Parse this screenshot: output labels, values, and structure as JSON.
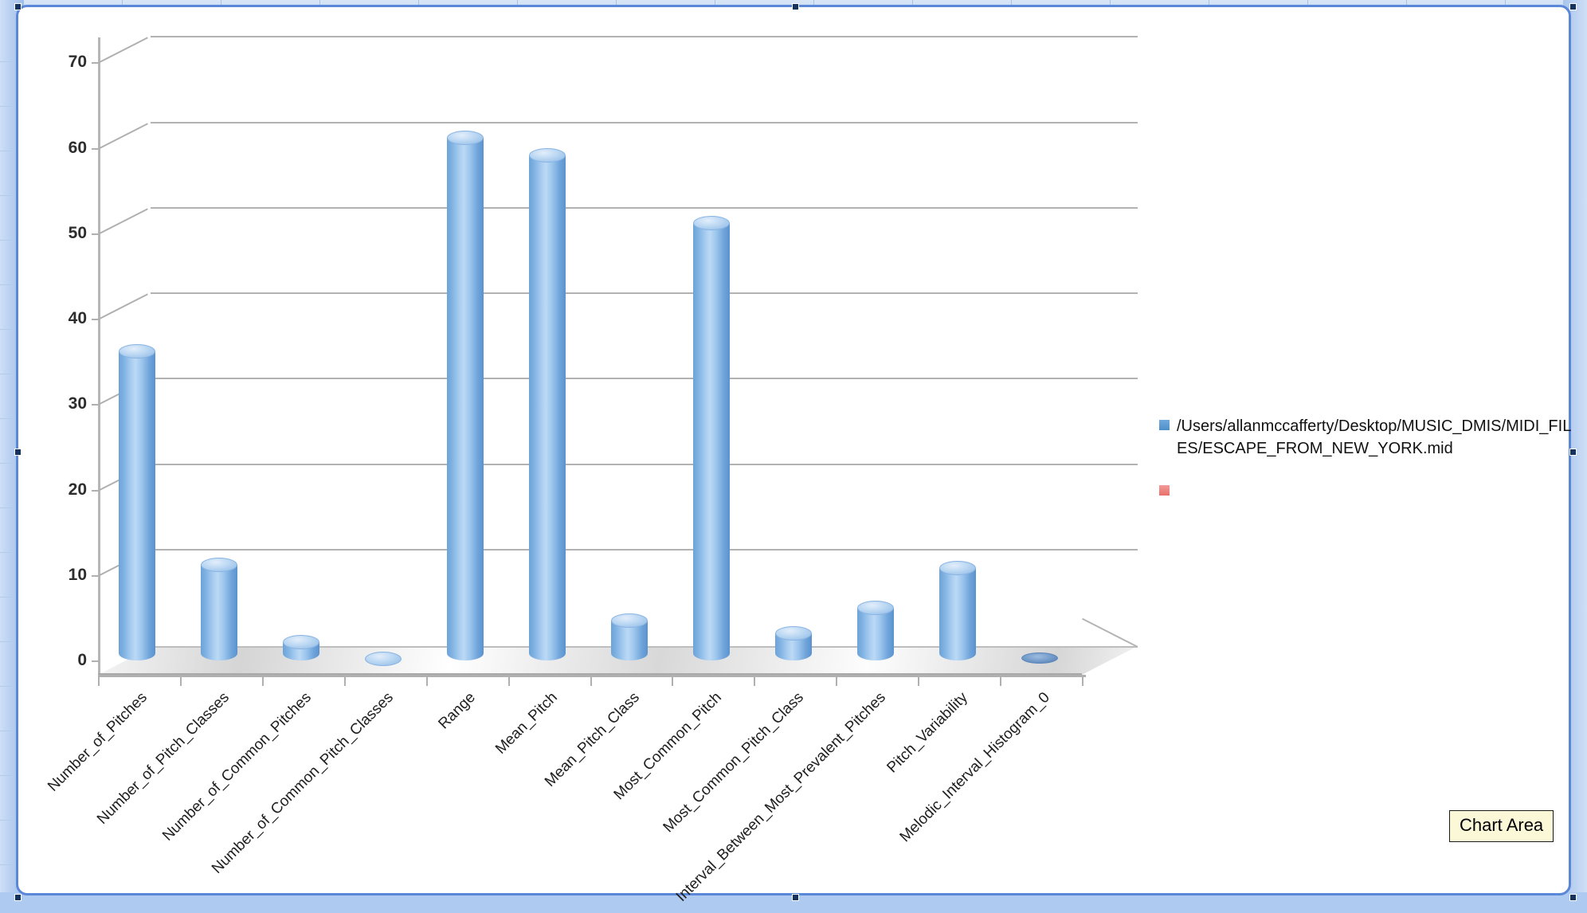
{
  "window": {
    "selected_object": "chart-object",
    "accent_color": "#5b87d8",
    "sheet_background": "#c3d6f0"
  },
  "tooltip": {
    "label": "Chart Area"
  },
  "legend": {
    "position": "right",
    "entries": [
      {
        "label": "/Users/allanmccafferty/Desktop/MUSIC_DMIS/MIDI_FILES/ESCAPE_FROM_NEW_YORK.mid",
        "color": "#4f8fc9"
      },
      {
        "label": "",
        "color": "#e8706c"
      }
    ]
  },
  "chart_data": {
    "type": "bar",
    "title": "",
    "xlabel": "",
    "ylabel": "",
    "ylim": [
      0,
      72
    ],
    "yticks": [
      0,
      10,
      20,
      30,
      40,
      50,
      60,
      70
    ],
    "grid": true,
    "style": "3d-cylinder",
    "legend_position": "right",
    "categories": [
      "Number_of_Pitches",
      "Number_of_Pitch_Classes",
      "Number_of_Common_Pitches",
      "Number_of_Common_Pitch_Classes",
      "Range",
      "Mean_Pitch",
      "Mean_Pitch_Class",
      "Most_Common_Pitch",
      "Most_Common_Pitch_Class",
      "Interval_Between_Most_Prevalent_Pitches",
      "Pitch_Variability",
      "Melodic_Interval_Histogram_0"
    ],
    "series": [
      {
        "name": "/Users/allanmccafferty/Desktop/MUSIC_DMIS/MIDI_FILES/ESCAPE_FROM_NEW_YORK.mid",
        "color": "#7fb2e2",
        "values": [
          37,
          12,
          3,
          1,
          62,
          60,
          5.5,
          52,
          4,
          7,
          11.7,
          0
        ]
      }
    ]
  }
}
